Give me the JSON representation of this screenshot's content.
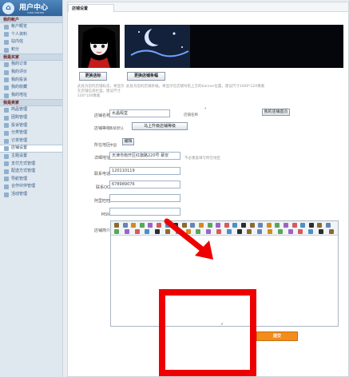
{
  "sidebar": {
    "title": "用户中心",
    "subtitle": "USER CENTER",
    "sections": [
      {
        "title": "我的帐户",
        "items": [
          "帐户概览",
          "个人资料",
          "站内信",
          "积分"
        ]
      },
      {
        "title": "我是买家",
        "items": [
          "我的订单",
          "我的评价",
          "我的投诉",
          "我的收藏",
          "我的地址"
        ]
      },
      {
        "title": "我是卖家",
        "items": [
          "商品管理",
          "团购管理",
          "投诉管理",
          "分类管理",
          "订单管理",
          "店铺设置",
          "主题设置",
          "支付方式管理",
          "配送方式管理",
          "导航管理",
          "合作伙伴管理",
          "活动管理"
        ]
      }
    ],
    "active_item": "店铺设置"
  },
  "tab": "店铺设置",
  "buttons": {
    "change_logo": "更换店标",
    "change_banner": "更换店铺条幅",
    "upgrade": "马上升级店铺等级",
    "edit": "编辑",
    "home": "我的店铺首页",
    "submit": "提交"
  },
  "hints": {
    "logo": "此处为您的店铺标志，将显示在店铺信息栏里。建议尺寸100*100像素",
    "banner": "此处为您的店铺条幅，将显示在店铺导航上方的banner位置，建议尺寸1000*120像素",
    "address": "不必重复填写所在地区"
  },
  "form": {
    "store_name": {
      "label": "店铺名称：",
      "value": "水晶殿堂",
      "note": "店铺名称"
    },
    "level": {
      "label": "店铺等级：",
      "value": "系统默认"
    },
    "region": {
      "label": "所在地区：",
      "value": "中国"
    },
    "address": {
      "label": "详细地址：",
      "value": "天津市南开区红旗路220号 慕安"
    },
    "phone": {
      "label": "联系电话：",
      "value": "120110119"
    },
    "qq": {
      "label": "联系QQ：",
      "value": "678989076"
    },
    "wangwang": {
      "label": "阿里旺旺：",
      "value": ""
    },
    "msn": {
      "label": "MSN：",
      "value": ""
    },
    "intro": {
      "label": "店铺简介："
    }
  },
  "editor": {
    "row1": [
      "源码",
      "剪切",
      "复制",
      "粘贴",
      "纯文本",
      "Word",
      "打印",
      "撤销",
      "重做",
      "全选",
      "清除",
      "预览",
      "查找",
      "拼写",
      "模板",
      "左对齐",
      "居中",
      "右对齐",
      "两端对齐",
      "编号",
      "项目",
      "缩进",
      "减少缩进",
      "上标",
      "下标",
      "全屏"
    ],
    "row2": [
      "H1·",
      "字体",
      "字号",
      "Ab",
      "T",
      "B",
      "I",
      "U",
      "ABC",
      "颜色",
      "背景",
      "图片",
      "Flash",
      "媒体",
      "表格",
      "水平线",
      "表情",
      "特殊字符",
      "分页",
      "链接",
      "取消链接",
      "关于"
    ]
  },
  "colors": {
    "accent": "#f18c1d",
    "highlight": "#ef0000",
    "sidebar": "#dfe7ef"
  }
}
